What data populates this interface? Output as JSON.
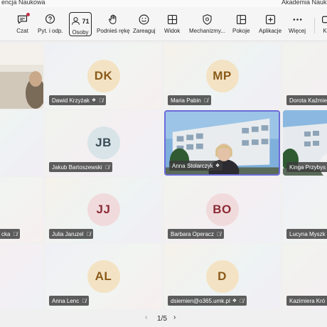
{
  "window": {
    "title_partial": "encja Naukowa",
    "title_right_partial": "Akademia Nauk"
  },
  "toolbar": {
    "chat_label": "Czat",
    "qa_label": "Pyt. i odp.",
    "people_label": "Osoby",
    "people_count": "71",
    "raise_hand_label": "Podnieś rękę",
    "react_label": "Zareaguj",
    "view_label": "Widok",
    "mechanisms_label": "Mechanizmy...",
    "rooms_label": "Pokoje",
    "apps_label": "Aplikacje",
    "more_label": "Więcej",
    "partial_right_label": "K"
  },
  "participants": [
    {
      "name": "",
      "initials": "",
      "video": true
    },
    {
      "name": "Dawid Krzyżak",
      "initials": "DK",
      "avatar_bg": "#f3e3c4",
      "avatar_fg": "#8a5a1a"
    },
    {
      "name": "Maria Pabin",
      "initials": "MP",
      "avatar_bg": "#f3e3c4",
      "avatar_fg": "#8a5a1a"
    },
    {
      "name": "Dorota Kaźmie",
      "initials": "",
      "video": false
    },
    {
      "name": "",
      "initials": ""
    },
    {
      "name": "Jakub Bartoszewski",
      "initials": "JB",
      "avatar_bg": "#d8e4e8",
      "avatar_fg": "#3c4d57"
    },
    {
      "name": "Anna Stolarczyk",
      "initials": "",
      "video": true
    },
    {
      "name": "Kinga Przybys",
      "initials": "",
      "video": true
    },
    {
      "name": "cka",
      "initials": ""
    },
    {
      "name": "Julia Jaruzel",
      "initials": "JJ",
      "avatar_bg": "#f1dadc",
      "avatar_fg": "#8c2b35"
    },
    {
      "name": "Barbara Operacz",
      "initials": "BO",
      "avatar_bg": "#f1dadc",
      "avatar_fg": "#8c2b35"
    },
    {
      "name": "Lucyna Myszk",
      "initials": ""
    },
    {
      "name": "",
      "initials": ""
    },
    {
      "name": "Anna Lenc",
      "initials": "AL",
      "avatar_bg": "#f3e3c4",
      "avatar_fg": "#8a5a1a"
    },
    {
      "name": "dsiemien@o365.umk.pl",
      "initials": "D",
      "avatar_bg": "#f3e3c4",
      "avatar_fg": "#8a5a1a"
    },
    {
      "name": "Kazimiera Kró",
      "initials": ""
    }
  ],
  "pager": {
    "page": "1/5",
    "prev_glyph": "‹",
    "next_glyph": "›"
  }
}
